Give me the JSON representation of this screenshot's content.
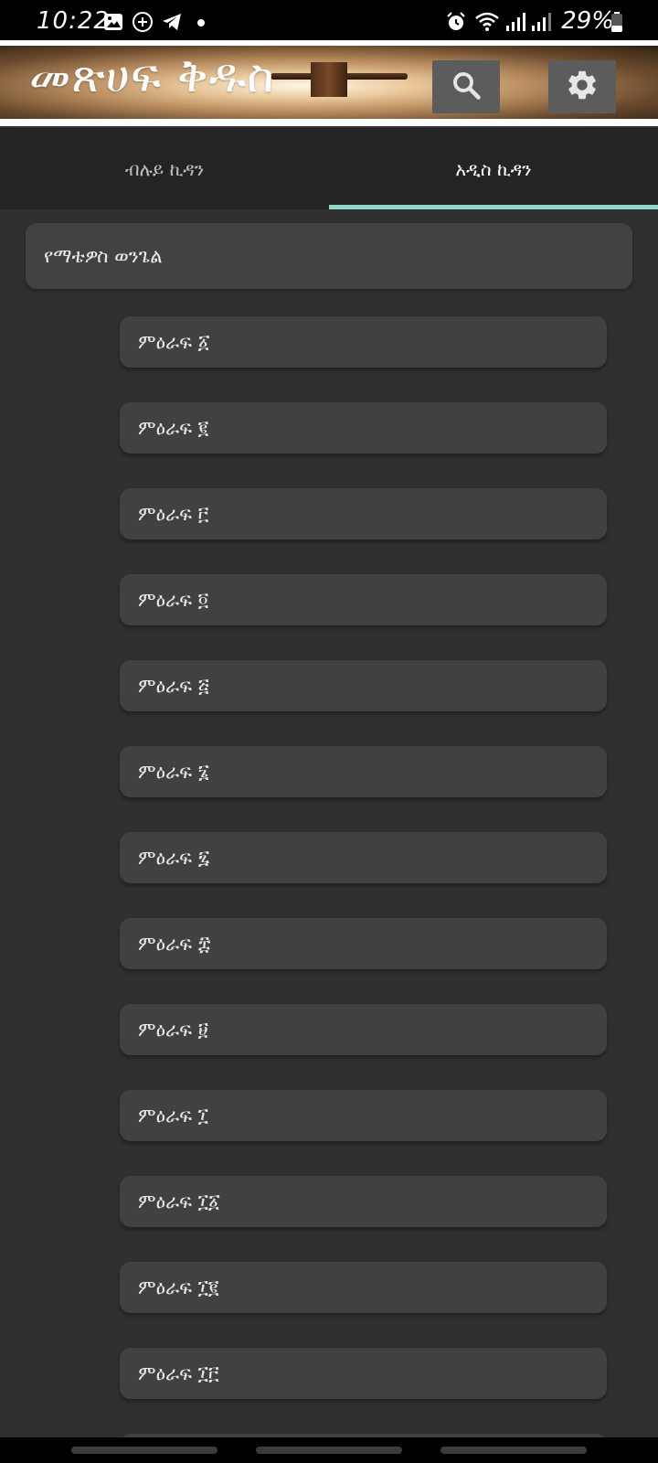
{
  "status_bar": {
    "time": "10:22",
    "battery": "29%",
    "icons": [
      "gallery-icon",
      "add-circle-icon",
      "telegram-icon",
      "dot-icon",
      "alarm-icon",
      "wifi-icon",
      "signal-icon",
      "signal-icon",
      "battery-icon"
    ]
  },
  "header": {
    "title": "መጽሀፍ ቅዱስ",
    "search_icon": "search-icon",
    "settings_icon": "gear-icon"
  },
  "tabs": [
    {
      "label": "ብሉይ ኪዳን",
      "active": false
    },
    {
      "label": "አዲስ ኪዳን",
      "active": true
    }
  ],
  "colors": {
    "accent": "#8fd9cc",
    "background": "#303030",
    "card": "#424242"
  },
  "book": {
    "title": "የማቴዎስ ወንጌል"
  },
  "chapters": [
    "ምዕራፍ ፩",
    "ምዕራፍ ፪",
    "ምዕራፍ ፫",
    "ምዕራፍ ፬",
    "ምዕራፍ ፭",
    "ምዕራፍ ፮",
    "ምዕራፍ ፯",
    "ምዕራፍ ፰",
    "ምዕራፍ ፱",
    "ምዕራፍ ፲",
    "ምዕራፍ ፲፩",
    "ምዕራፍ ፲፪",
    "ምዕራፍ ፲፫"
  ]
}
